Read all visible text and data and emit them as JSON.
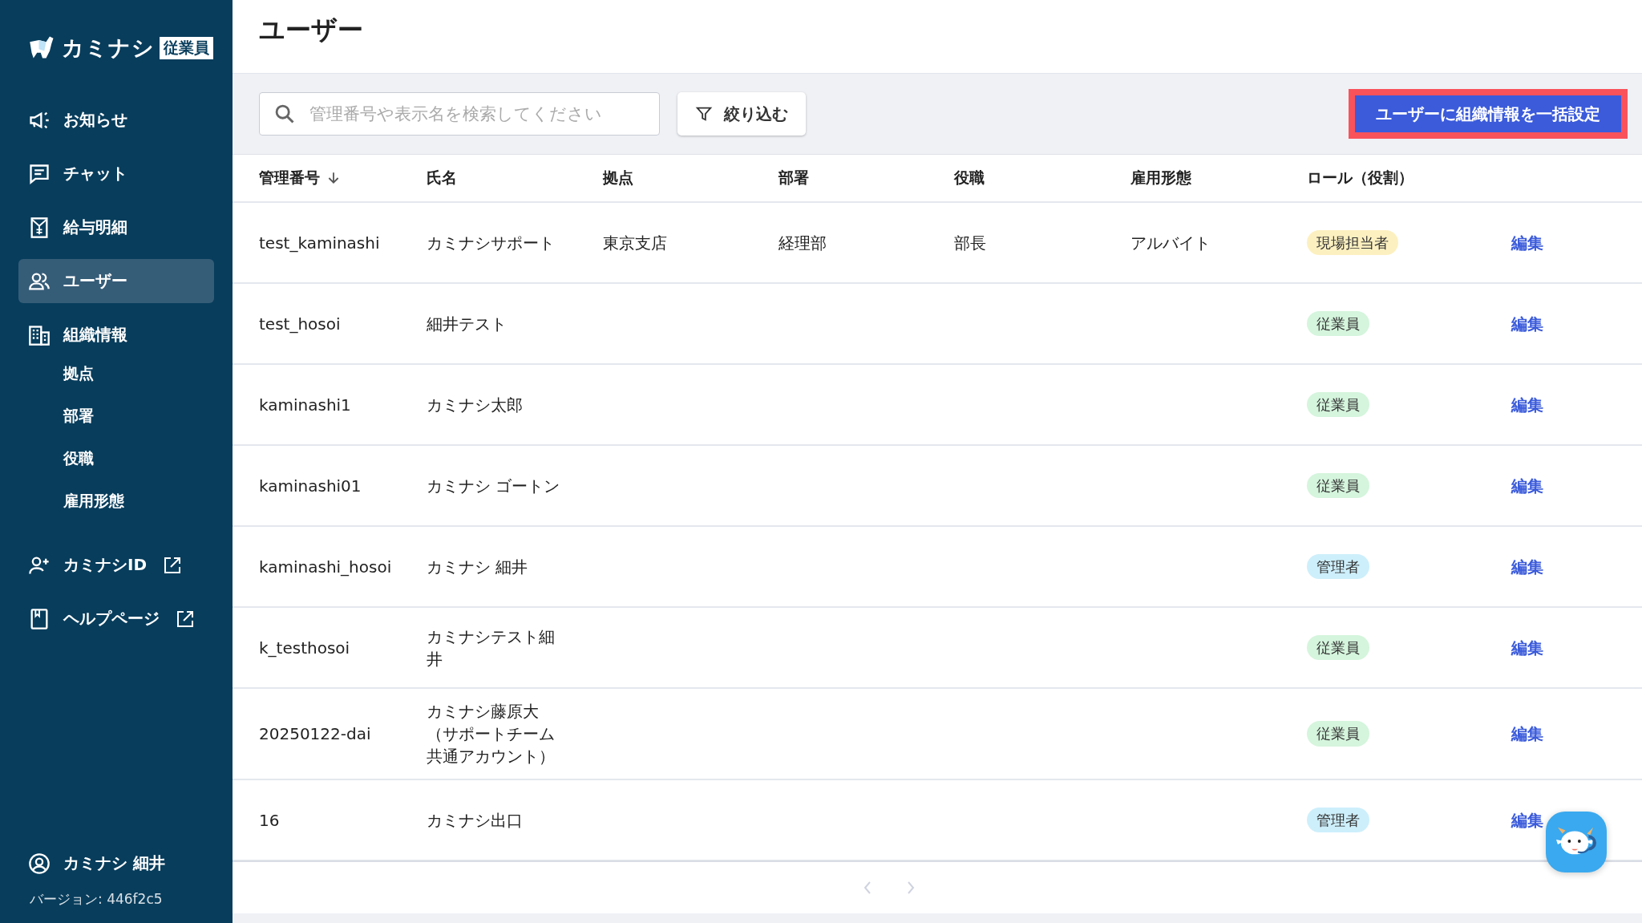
{
  "sidebar": {
    "logo": {
      "brand": "カミナシ",
      "badge": "従業員"
    },
    "items": [
      {
        "label": "お知らせ",
        "selected": false
      },
      {
        "label": "チャット",
        "selected": false
      },
      {
        "label": "給与明細",
        "selected": false
      },
      {
        "label": "ユーザー",
        "selected": true
      },
      {
        "label": "組織情報",
        "selected": false,
        "children": [
          {
            "label": "拠点"
          },
          {
            "label": "部署"
          },
          {
            "label": "役職"
          },
          {
            "label": "雇用形態"
          }
        ]
      }
    ],
    "links": [
      {
        "label": "カミナシID",
        "external": true
      },
      {
        "label": "ヘルプページ",
        "external": true
      }
    ],
    "user": {
      "name": "カミナシ 細井"
    },
    "version": "バージョン: 446f2c5"
  },
  "page": {
    "title": "ユーザー"
  },
  "toolbar": {
    "search": {
      "placeholder": "管理番号や表示名を検索してください"
    },
    "filter_button": "絞り込む",
    "bulk_button": {
      "label": "ユーザーに組織情報を一括設定",
      "highlighted": true
    }
  },
  "table": {
    "columns": [
      {
        "label": "管理番号",
        "sorted": true
      },
      {
        "label": "氏名",
        "sorted": false
      },
      {
        "label": "拠点",
        "sorted": false
      },
      {
        "label": "部署",
        "sorted": false
      },
      {
        "label": "役職",
        "sorted": false
      },
      {
        "label": "雇用形態",
        "sorted": false
      },
      {
        "label": "ロール（役割）",
        "sorted": false
      }
    ],
    "rows": [
      {
        "id": "test_kaminashi",
        "name": "カミナシサポート",
        "site": "東京支店",
        "department": "経理部",
        "position": "部長",
        "employment": "アルバイト",
        "role": {
          "label": "現場担当者",
          "color": "#fdf0c0"
        },
        "action": "編集"
      },
      {
        "id": "test_hosoi",
        "name": "細井テスト",
        "role": {
          "label": "従業員",
          "color": "#d5f5dd"
        },
        "action": "編集"
      },
      {
        "id": "kaminashi1",
        "name": "カミナシ太郎",
        "role": {
          "label": "従業員",
          "color": "#d5f5dd"
        },
        "action": "編集"
      },
      {
        "id": "kaminashi01",
        "name": "カミナシ ゴートン",
        "role": {
          "label": "従業員",
          "color": "#d5f5dd"
        },
        "action": "編集"
      },
      {
        "id": "kaminashi_hosoi",
        "name": "カミナシ 細井",
        "role": {
          "label": "管理者",
          "color": "#cdeffb"
        },
        "action": "編集"
      },
      {
        "id": "k_testhosoi",
        "name": "カミナシテスト細井",
        "role": {
          "label": "従業員",
          "color": "#d5f5dd"
        },
        "action": "編集"
      },
      {
        "id": "20250122-dai",
        "name": "カミナシ藤原大（サポートチーム共通アカウント）",
        "role": {
          "label": "従業員",
          "color": "#d5f5dd"
        },
        "action": "編集"
      },
      {
        "id": "16",
        "name": "カミナシ出口",
        "role": {
          "label": "管理者",
          "color": "#cdeffb"
        },
        "action": "編集"
      }
    ]
  }
}
